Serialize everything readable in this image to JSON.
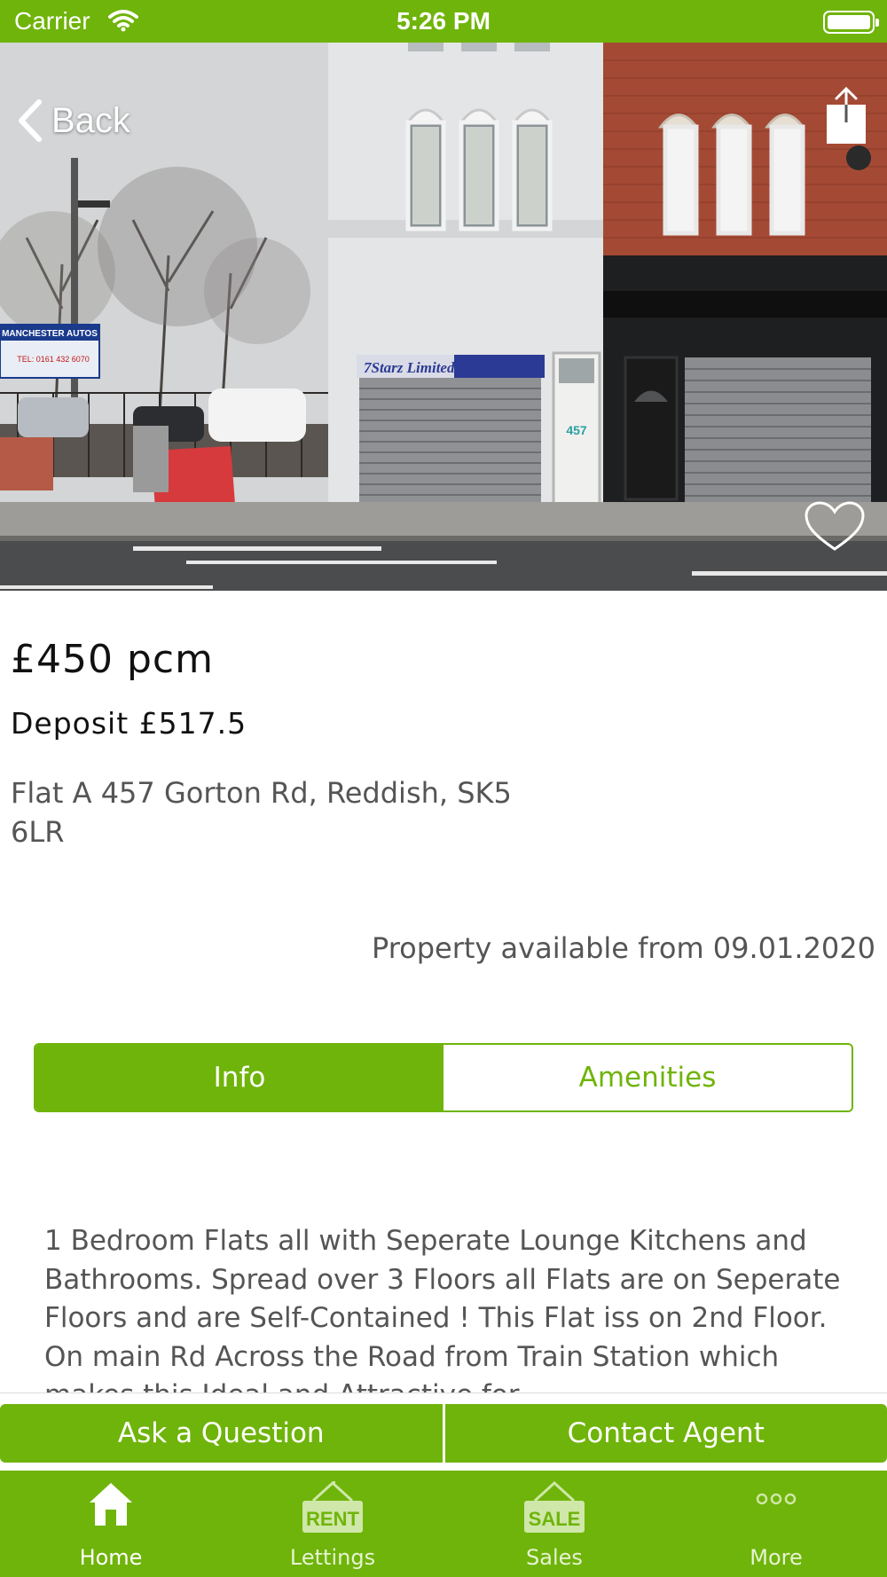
{
  "status_bar": {
    "carrier": "Carrier",
    "time": "5:26 PM"
  },
  "hero": {
    "back_label": "Back",
    "shop_sign_text": "7Starz Limited",
    "dealer_sign_text": "MANCHESTER AUTOS",
    "dealer_phone": "TEL: 0161 432 6070",
    "door_number": "457"
  },
  "listing": {
    "price": "£450 pcm",
    "deposit": "Deposit £517.5",
    "address": "Flat A 457 Gorton Rd, Reddish, SK5 6LR",
    "availability": "Property available from 09.01.2020"
  },
  "segmented_control": {
    "info_label": "Info",
    "amenities_label": "Amenities",
    "selected": "Info"
  },
  "description": "1 Bedroom Flats all with Seperate Lounge Kitchens and Bathrooms. Spread over 3 Floors all Flats are on Seperate Floors and are Self-Contained ! This Flat iss on 2nd Floor. On main Rd Across the Road from Train Station which makes this Ideal and Attractive for",
  "actions": {
    "ask_label": "Ask a Question",
    "contact_label": "Contact Agent"
  },
  "tab_bar": {
    "tabs": [
      {
        "label": "Home",
        "icon": "home-icon"
      },
      {
        "label": "Lettings",
        "icon": "rent-sign-icon",
        "icon_text": "RENT"
      },
      {
        "label": "Sales",
        "icon": "sale-sign-icon",
        "icon_text": "SALE"
      },
      {
        "label": "More",
        "icon": "more-dots-icon"
      }
    ],
    "active": "Home"
  },
  "colors": {
    "brand_green": "#6fb40a",
    "text_grey": "#555555"
  }
}
